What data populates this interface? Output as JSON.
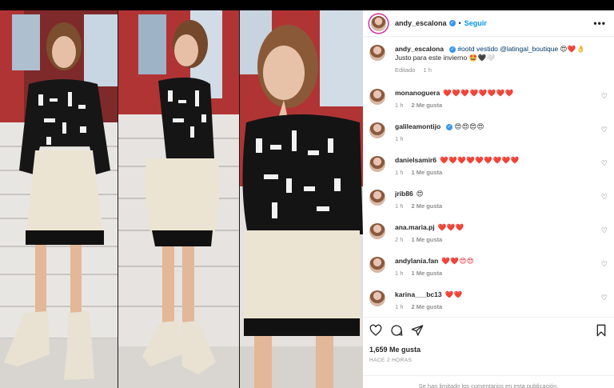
{
  "header": {
    "username": "andy_escalona",
    "separator": "•",
    "follow_label": "Seguir",
    "more_label": "•••"
  },
  "caption": {
    "username": "andy_escalona",
    "text_pre": "#ootd vestido",
    "mention": "@latingal_boutique",
    "emoji1": "😍❤️👌",
    "text2": "Justo para este invierno",
    "emoji2": "🤩🖤🤍",
    "edited": "Editado",
    "time": "1 h"
  },
  "comments": [
    {
      "username": "monanoguera",
      "text": "❤️❤️❤️❤️❤️❤️❤️❤️",
      "time": "1 h",
      "likes": "2 Me gusta"
    },
    {
      "username": "galileamontijo",
      "text": "😍😍😍😍",
      "time": "1 h",
      "likes": ""
    },
    {
      "username": "danielsamir6",
      "text": "❤️❤️❤️❤️❤️❤️❤️❤️❤️",
      "time": "1 h",
      "likes": "1 Me gusta"
    },
    {
      "username": "jrib86",
      "text": "😍",
      "time": "1 h",
      "likes": "2 Me gusta"
    },
    {
      "username": "ana.maria.pj",
      "text": "❤️❤️❤️",
      "time": "2 h",
      "likes": "1 Me gusta"
    },
    {
      "username": "andylania.fan",
      "text": "❤️❤️😍😍",
      "time": "1 h",
      "likes": "1 Me gusta"
    },
    {
      "username": "karina___bc13",
      "text": "❤️❤️",
      "time": "1 h",
      "likes": "2 Me gusta"
    }
  ],
  "footer": {
    "likes_total": "1,659 Me gusta",
    "time_ago": "HACE 2 HORAS",
    "comments_limited": "Se han limitado los comentarios en esta publicación."
  },
  "icons": {
    "like": "heart-icon",
    "comment": "comment-icon",
    "share": "send-icon",
    "save": "bookmark-icon"
  },
  "colors": {
    "accent": "#0095f6",
    "verified": "#3897f0",
    "heart": "#e0202a",
    "muted": "#8e8e8e"
  }
}
